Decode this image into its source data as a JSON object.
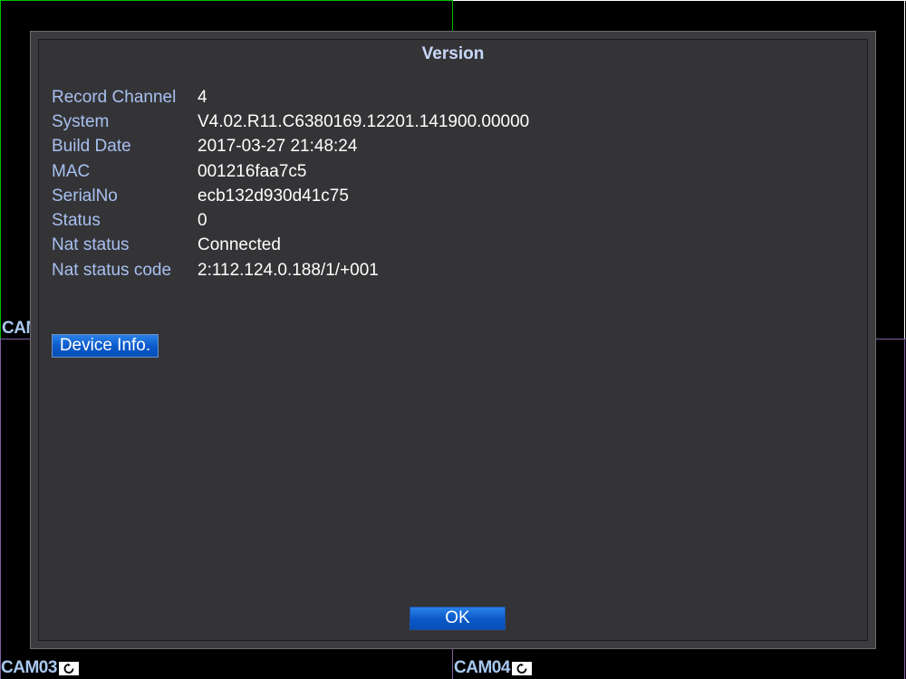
{
  "dialog": {
    "title": "Version",
    "fields": [
      {
        "label": "Record Channel",
        "value": "4"
      },
      {
        "label": "System",
        "value": "V4.02.R11.C6380169.12201.141900.00000"
      },
      {
        "label": "Build Date",
        "value": "2017-03-27 21:48:24"
      },
      {
        "label": "MAC",
        "value": "001216faa7c5"
      },
      {
        "label": "SerialNo",
        "value": "ecb132d930d41c75"
      },
      {
        "label": "Status",
        "value": "0"
      },
      {
        "label": "Nat status",
        "value": "Connected"
      },
      {
        "label": "Nat status code",
        "value": "2:112.124.0.188/1/+001"
      }
    ],
    "device_info_label": "Device Info.",
    "ok_label": "OK"
  },
  "cameras": {
    "partial_label": "CAM",
    "cam03": "CAM03",
    "cam04": "CAM04",
    "record_icon": "refresh-icon"
  },
  "colors": {
    "label_blue": "#a8c0f0",
    "button_blue": "#0a58c8",
    "dialog_bg": "#343437"
  }
}
